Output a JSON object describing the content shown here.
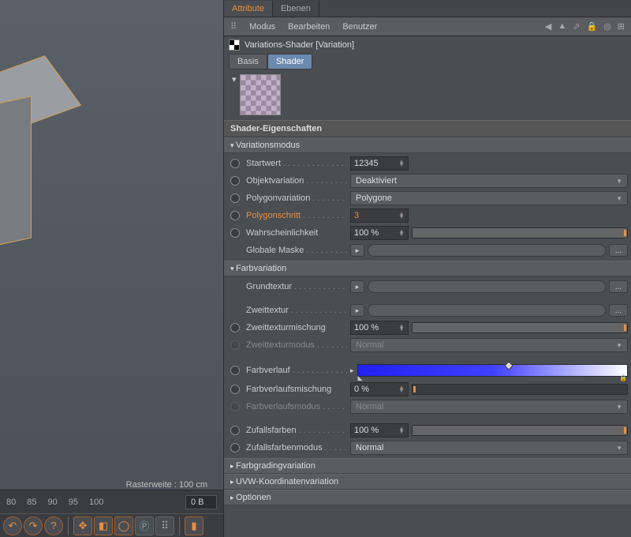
{
  "viewport": {
    "raster_label": "Rasterweite : 100 cm",
    "timeline": {
      "ticks": [
        "80",
        "85",
        "90",
        "95",
        "100"
      ],
      "frame_field": "0 B"
    },
    "toolbar_icons": [
      "undo",
      "redo",
      "help",
      "move",
      "scale",
      "rotate",
      "coord",
      "snap",
      "grid",
      "record"
    ]
  },
  "panel": {
    "tabs": {
      "attribute": "Attribute",
      "layers": "Ebenen"
    },
    "menubar": {
      "mode": "Modus",
      "edit": "Bearbeiten",
      "user": "Benutzer"
    },
    "object_name": "Variations-Shader [Variation]",
    "subtabs": {
      "basis": "Basis",
      "shader": "Shader"
    },
    "section_title": "Shader-Eigenschaften",
    "groups": {
      "variation_mode": {
        "title": "Variationsmodus",
        "startwert": {
          "label": "Startwert",
          "value": "12345"
        },
        "objektvariation": {
          "label": "Objektvariation",
          "value": "Deaktiviert"
        },
        "polygonvariation": {
          "label": "Polygonvariation",
          "value": "Polygone"
        },
        "polygonschritt": {
          "label": "Polygonschritt",
          "value": "3"
        },
        "wahrscheinlichkeit": {
          "label": "Wahrscheinlichkeit",
          "value": "100 %"
        },
        "globale_maske": {
          "label": "Globale Maske"
        }
      },
      "farbvariation": {
        "title": "Farbvariation",
        "grundtextur": {
          "label": "Grundtextur"
        },
        "zweittextur": {
          "label": "Zweittextur"
        },
        "zweittexturmischung": {
          "label": "Zweittexturmischung",
          "value": "100 %"
        },
        "zweittexturmodus": {
          "label": "Zweittexturmodus",
          "value": "Normal"
        },
        "farbverlauf": {
          "label": "Farbverlauf"
        },
        "farbverlaufsmischung": {
          "label": "Farbverlaufsmischung",
          "value": "0 %"
        },
        "farbverlaufsmodus": {
          "label": "Farbverlaufsmodus",
          "value": "Normal"
        },
        "zufallsfarben": {
          "label": "Zufallsfarben",
          "value": "100 %"
        },
        "zufallsfarbenmodus": {
          "label": "Zufallsfarbenmodus",
          "value": "Normal"
        }
      },
      "farbgrading": {
        "title": "Farbgradingvariation"
      },
      "uvw": {
        "title": "UVW-Koordinatenvariation"
      },
      "optionen": {
        "title": "Optionen"
      }
    }
  }
}
